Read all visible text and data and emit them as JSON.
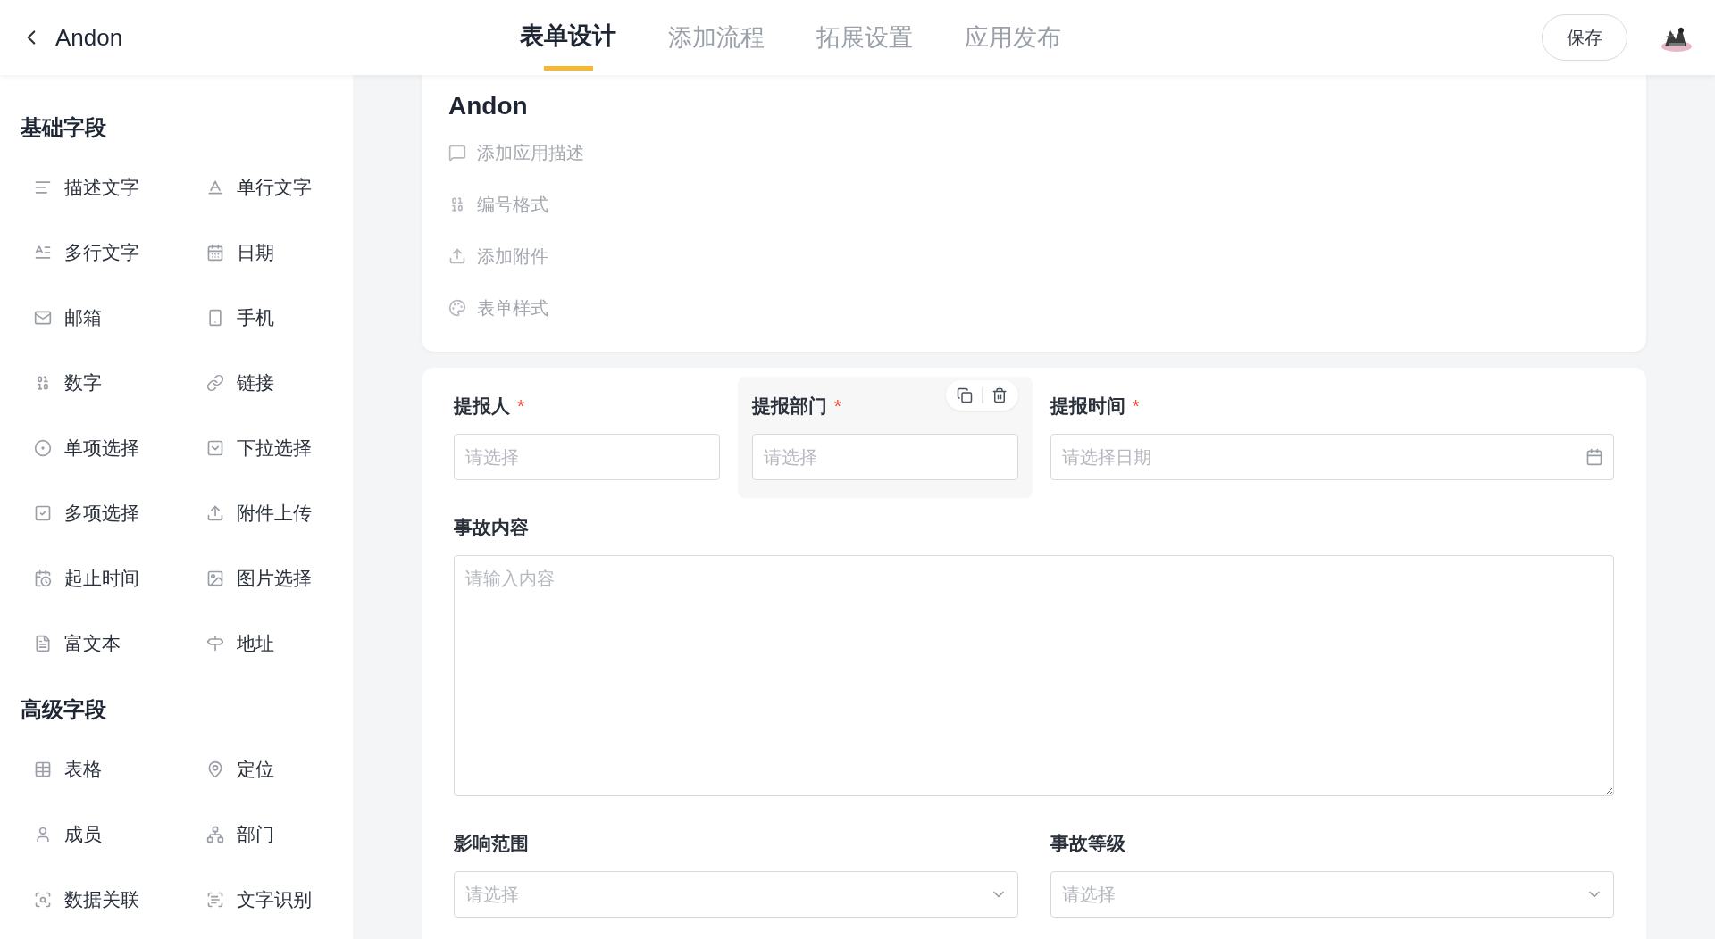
{
  "header": {
    "title": "Andon",
    "tabs": [
      {
        "label": "表单设计",
        "selected": true
      },
      {
        "label": "添加流程",
        "selected": false
      },
      {
        "label": "拓展设置",
        "selected": false
      },
      {
        "label": "应用发布",
        "selected": false
      }
    ],
    "save_button": "保存"
  },
  "sidebar": {
    "sections": [
      {
        "title": "基础字段",
        "items": [
          "描述文字",
          "单行文字",
          "多行文字",
          "日期",
          "邮箱",
          "手机",
          "数字",
          "链接",
          "单项选择",
          "下拉选择",
          "多项选择",
          "附件上传",
          "起止时间",
          "图片选择",
          "富文本",
          "地址"
        ]
      },
      {
        "title": "高级字段",
        "items": [
          "表格",
          "定位",
          "成员",
          "部门",
          "数据关联",
          "文字识别"
        ]
      }
    ]
  },
  "app_card": {
    "title": "Andon",
    "options": [
      "添加应用描述",
      "编号格式",
      "添加附件",
      "表单样式"
    ]
  },
  "form": {
    "required_mark": "*",
    "fields": [
      {
        "kind": "select",
        "label": "提报人",
        "required": true,
        "placeholder": "请选择",
        "selected": false
      },
      {
        "kind": "select",
        "label": "提报部门",
        "required": true,
        "placeholder": "请选择",
        "selected": true
      },
      {
        "kind": "date",
        "label": "提报时间",
        "required": true,
        "placeholder": "请选择日期",
        "selected": false
      },
      {
        "kind": "textarea",
        "label": "事故内容",
        "required": false,
        "placeholder": "请输入内容",
        "selected": false
      },
      {
        "kind": "dropdown",
        "label": "影响范围",
        "required": false,
        "placeholder": "请选择",
        "selected": false
      },
      {
        "kind": "dropdown",
        "label": "事故等级",
        "required": false,
        "placeholder": "请选择",
        "selected": false
      }
    ]
  }
}
